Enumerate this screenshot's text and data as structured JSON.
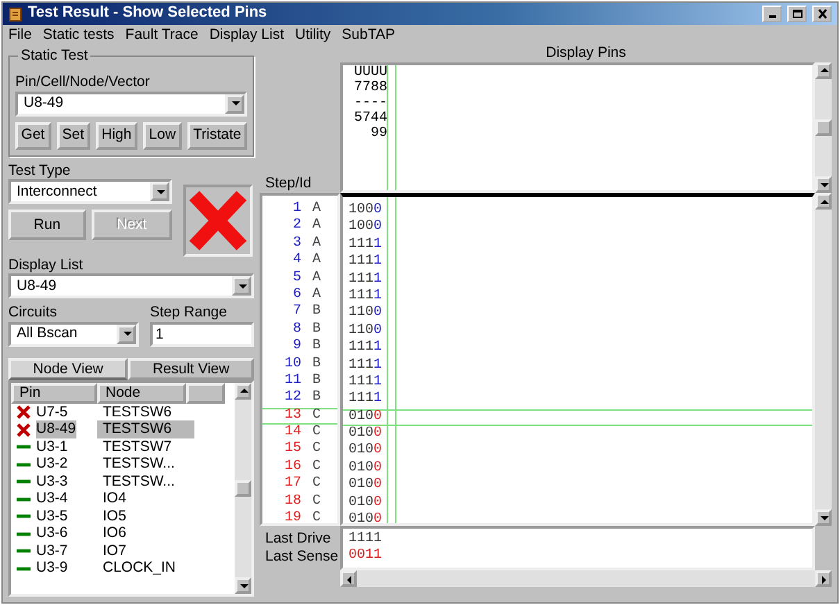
{
  "window": {
    "title": "Test Result - Show Selected Pins"
  },
  "menu": [
    "File",
    "Static tests",
    "Fault Trace",
    "Display List",
    "Utility",
    "SubTAP"
  ],
  "static_test": {
    "title": "Static Test",
    "field_label": "Pin/Cell/Node/Vector",
    "value": "U8-49",
    "buttons": [
      "Get",
      "Set",
      "High",
      "Low",
      "Tristate"
    ]
  },
  "test_type": {
    "label": "Test Type",
    "value": "Interconnect"
  },
  "run_buttons": [
    {
      "label": "Run",
      "disabled": false
    },
    {
      "label": "Next",
      "disabled": true
    }
  ],
  "result": {
    "kind": "fail"
  },
  "display_list": {
    "label": "Display List",
    "value": "U8-49"
  },
  "circuits": {
    "label": "Circuits",
    "value": "All Bscan"
  },
  "step_range": {
    "label": "Step Range",
    "value": "1"
  },
  "view_tabs": [
    {
      "label": "Node View",
      "selected": true
    },
    {
      "label": "Result View",
      "selected": false
    }
  ],
  "pin_list": {
    "columns": [
      "Pin",
      "Node"
    ],
    "rows": [
      {
        "pin": "U7-5",
        "node": "TESTSW6",
        "kind": "fail",
        "selected": false
      },
      {
        "pin": "U8-49",
        "node": "TESTSW6",
        "kind": "fail",
        "selected": true
      },
      {
        "pin": "U3-1",
        "node": "TESTSW7",
        "kind": "pass",
        "selected": false
      },
      {
        "pin": "U3-2",
        "node": "TESTSW...",
        "kind": "pass",
        "selected": false
      },
      {
        "pin": "U3-3",
        "node": "TESTSW...",
        "kind": "pass",
        "selected": false
      },
      {
        "pin": "U3-4",
        "node": "IO4",
        "kind": "pass",
        "selected": false
      },
      {
        "pin": "U3-5",
        "node": "IO5",
        "kind": "pass",
        "selected": false
      },
      {
        "pin": "U3-6",
        "node": "IO6",
        "kind": "pass",
        "selected": false
      },
      {
        "pin": "U3-7",
        "node": "IO7",
        "kind": "pass",
        "selected": false
      },
      {
        "pin": "U3-9",
        "node": "CLOCK_IN",
        "kind": "pass",
        "selected": false
      }
    ]
  },
  "display_pins": {
    "title": "Display Pins",
    "header_lines": [
      "UUUU",
      "7788",
      "----",
      "5744",
      "99"
    ]
  },
  "steps": {
    "title": "Step/Id",
    "rows": [
      {
        "step": "1",
        "id": "A",
        "value": "1000",
        "kind": "pass",
        "selected": false
      },
      {
        "step": "2",
        "id": "A",
        "value": "1000",
        "kind": "pass",
        "selected": false
      },
      {
        "step": "3",
        "id": "A",
        "value": "1111",
        "kind": "pass",
        "selected": false
      },
      {
        "step": "4",
        "id": "A",
        "value": "1111",
        "kind": "pass",
        "selected": false
      },
      {
        "step": "5",
        "id": "A",
        "value": "1111",
        "kind": "pass",
        "selected": false
      },
      {
        "step": "6",
        "id": "A",
        "value": "1111",
        "kind": "pass",
        "selected": false
      },
      {
        "step": "7",
        "id": "B",
        "value": "1100",
        "kind": "pass",
        "selected": false
      },
      {
        "step": "8",
        "id": "B",
        "value": "1100",
        "kind": "pass",
        "selected": false
      },
      {
        "step": "9",
        "id": "B",
        "value": "1111",
        "kind": "pass",
        "selected": false
      },
      {
        "step": "10",
        "id": "B",
        "value": "1111",
        "kind": "pass",
        "selected": false
      },
      {
        "step": "11",
        "id": "B",
        "value": "1111",
        "kind": "pass",
        "selected": false
      },
      {
        "step": "12",
        "id": "B",
        "value": "1111",
        "kind": "pass",
        "selected": false
      },
      {
        "step": "13",
        "id": "C",
        "value": "0100",
        "kind": "fail",
        "selected": true
      },
      {
        "step": "14",
        "id": "C",
        "value": "0100",
        "kind": "fail",
        "selected": false
      },
      {
        "step": "15",
        "id": "C",
        "value": "0100",
        "kind": "fail",
        "selected": false
      },
      {
        "step": "16",
        "id": "C",
        "value": "0100",
        "kind": "fail",
        "selected": false
      },
      {
        "step": "17",
        "id": "C",
        "value": "0100",
        "kind": "fail",
        "selected": false
      },
      {
        "step": "18",
        "id": "C",
        "value": "0100",
        "kind": "fail",
        "selected": false
      },
      {
        "step": "19",
        "id": "C",
        "value": "0100",
        "kind": "fail",
        "selected": false
      }
    ]
  },
  "last": [
    {
      "label": "Last Drive",
      "value": "1111",
      "kind": "drive"
    },
    {
      "label": "Last Sense",
      "value": "0011",
      "kind": "sense"
    }
  ]
}
